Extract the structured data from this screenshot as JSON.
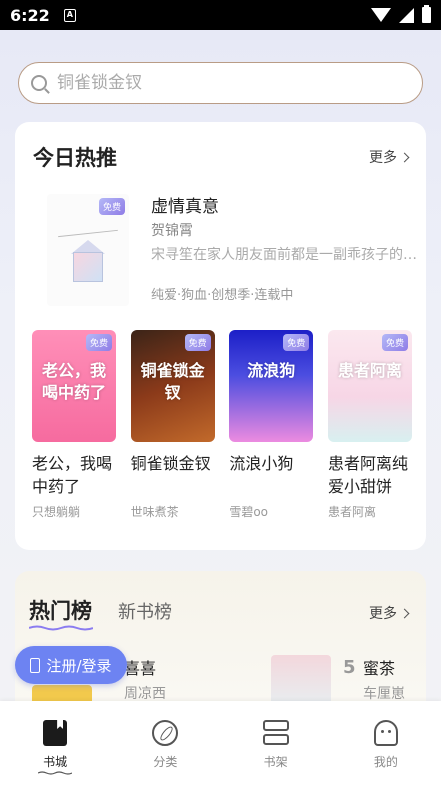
{
  "status": {
    "time": "6:22",
    "sim": "A"
  },
  "search": {
    "placeholder": "铜雀锁金钗"
  },
  "hot_today": {
    "title": "今日热推",
    "more": "更多",
    "featured": {
      "badge": "免费",
      "title": "虚情真意",
      "author": "贺锦霄",
      "description": "宋寻笙在家人朋友面前都是一副乖孩子的模样…",
      "tags": "纯爱·狗血·创想季·连载中"
    },
    "books": [
      {
        "badge": "免费",
        "cover_text": "老公，我喝中药了",
        "title": "老公，我喝中药了",
        "author": "只想躺躺"
      },
      {
        "badge": "免费",
        "cover_text": "铜雀锁金钗",
        "title": "铜雀锁金钗",
        "author": "世味煮茶"
      },
      {
        "badge": "免费",
        "cover_text": "流浪狗",
        "title": "流浪小狗",
        "author": "雪碧oo"
      },
      {
        "badge": "免费",
        "cover_text": "患者阿离",
        "title": "患者阿离纯爱小甜饼",
        "author": "患者阿离"
      }
    ]
  },
  "ranking": {
    "tab_active": "热门榜",
    "tab_inactive": "新书榜",
    "more": "更多",
    "items": [
      {
        "title": "喜喜",
        "author": "周凉西"
      },
      {
        "rank": "5",
        "title": "蜜茶",
        "author": "车厘崽"
      }
    ]
  },
  "login_button": "注册/登录",
  "nav": [
    {
      "label": "书城",
      "icon": "book-icon",
      "active": true
    },
    {
      "label": "分类",
      "icon": "compass-icon",
      "active": false
    },
    {
      "label": "书架",
      "icon": "bookshelf-icon",
      "active": false
    },
    {
      "label": "我的",
      "icon": "profile-icon",
      "active": false
    }
  ],
  "colors": {
    "accent": "#6d83f2",
    "search_border": "#b99c86",
    "badge": "#8f7ce6"
  }
}
